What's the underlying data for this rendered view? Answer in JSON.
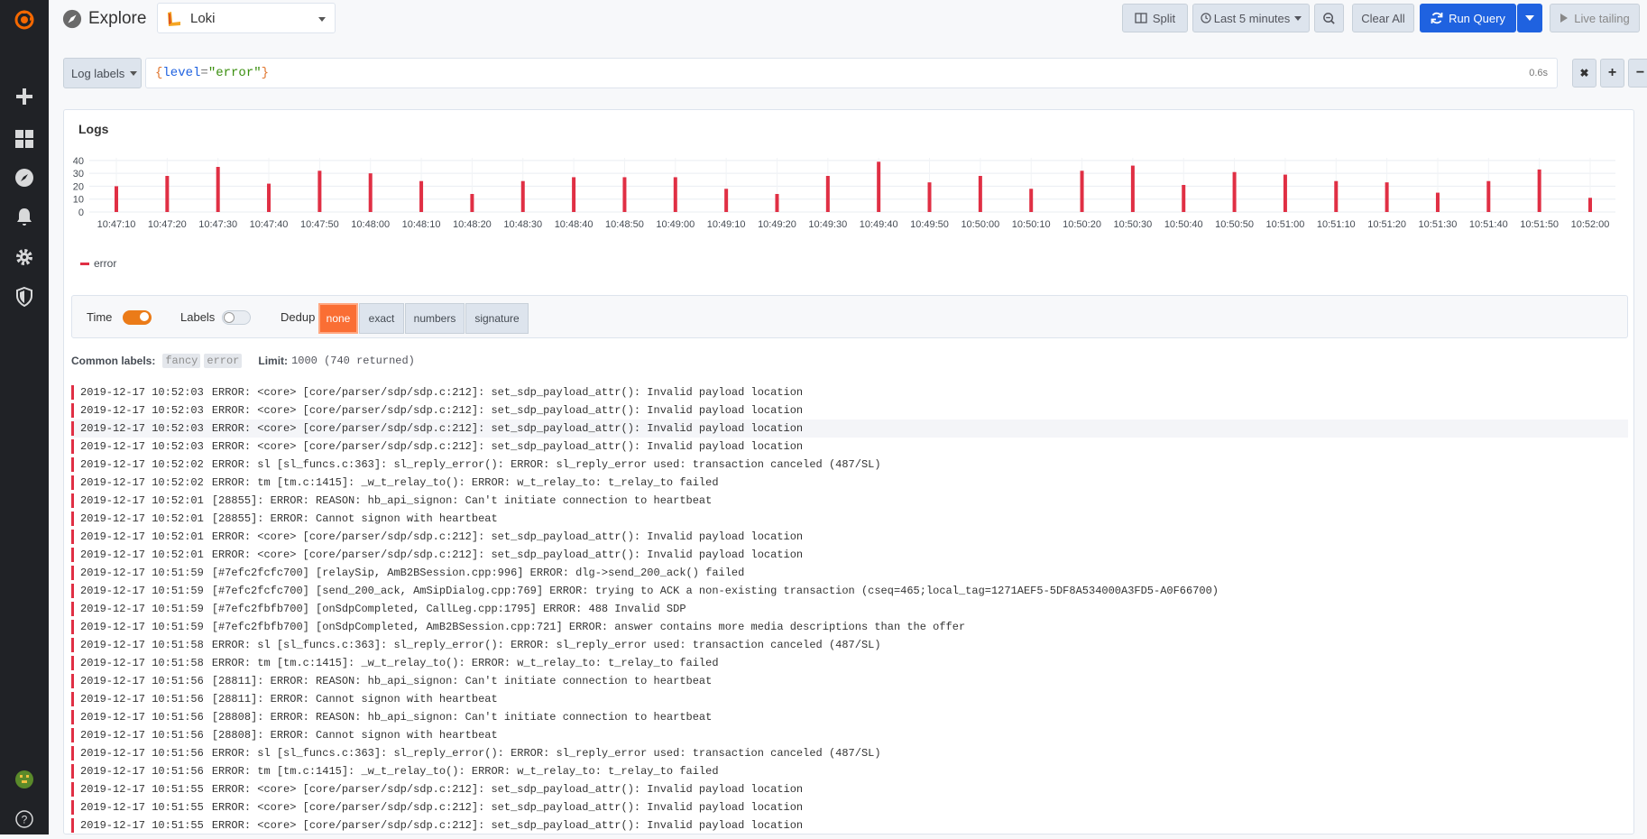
{
  "header": {
    "title": "Explore",
    "datasource": "Loki",
    "split_label": "Split",
    "time_range_label": "Last 5 minutes",
    "clear_all_label": "Clear All",
    "run_query_label": "Run Query",
    "live_tailing_label": "Live tailing"
  },
  "query": {
    "log_labels_label": "Log labels",
    "expr": {
      "open": "{",
      "key": "level",
      "op": "=",
      "value": "\"error\"",
      "close": "}"
    },
    "duration": "0.6s",
    "remove_symbol": "✖",
    "add_symbol": "+",
    "minus_symbol": "−"
  },
  "panel": {
    "title": "Logs",
    "legend_label": "error"
  },
  "chart_data": {
    "type": "bar",
    "yticks": [
      0,
      10,
      20,
      30,
      40
    ],
    "ylim": [
      0,
      42
    ],
    "xticks": [
      "10:47:10",
      "10:47:20",
      "10:47:30",
      "10:47:40",
      "10:47:50",
      "10:48:00",
      "10:48:10",
      "10:48:20",
      "10:48:30",
      "10:48:40",
      "10:48:50",
      "10:49:00",
      "10:49:10",
      "10:49:20",
      "10:49:30",
      "10:49:40",
      "10:49:50",
      "10:50:00",
      "10:50:10",
      "10:50:20",
      "10:50:30",
      "10:50:40",
      "10:50:50",
      "10:51:00",
      "10:51:10",
      "10:51:20",
      "10:51:30",
      "10:51:40",
      "10:51:50",
      "10:52:00"
    ],
    "series": [
      {
        "name": "error",
        "color": "#e02f44",
        "values": [
          20,
          28,
          35,
          22,
          32,
          30,
          24,
          14,
          24,
          27,
          27,
          27,
          18,
          14,
          28,
          39,
          23,
          28,
          18,
          32,
          36,
          21,
          31,
          29,
          24,
          23,
          15,
          24,
          33,
          11
        ]
      }
    ]
  },
  "options": {
    "time_label": "Time",
    "labels_label": "Labels",
    "dedup_label": "Dedup",
    "dedup_options": [
      "none",
      "exact",
      "numbers",
      "signature"
    ],
    "dedup_selected": "none"
  },
  "common": {
    "label": "Common labels:",
    "chips": [
      "fancy",
      "error"
    ],
    "limit_label": "Limit:",
    "limit_value": "1000 (740 returned)"
  },
  "logs": [
    {
      "ts": "2019-12-17 10:52:03",
      "msg": "ERROR: <core> [core/parser/sdp/sdp.c:212]: set_sdp_payload_attr(): Invalid payload location"
    },
    {
      "ts": "2019-12-17 10:52:03",
      "msg": "ERROR: <core> [core/parser/sdp/sdp.c:212]: set_sdp_payload_attr(): Invalid payload location"
    },
    {
      "ts": "2019-12-17 10:52:03",
      "msg": "ERROR: <core> [core/parser/sdp/sdp.c:212]: set_sdp_payload_attr(): Invalid payload location"
    },
    {
      "ts": "2019-12-17 10:52:03",
      "msg": "ERROR: <core> [core/parser/sdp/sdp.c:212]: set_sdp_payload_attr(): Invalid payload location"
    },
    {
      "ts": "2019-12-17 10:52:02",
      "msg": "ERROR: sl [sl_funcs.c:363]: sl_reply_error(): ERROR: sl_reply_error used: transaction canceled (487/SL)"
    },
    {
      "ts": "2019-12-17 10:52:02",
      "msg": "ERROR: tm [tm.c:1415]: _w_t_relay_to(): ERROR: w_t_relay_to: t_relay_to failed"
    },
    {
      "ts": "2019-12-17 10:52:01",
      "msg": "[28855]: ERROR: REASON: hb_api_signon: Can't initiate connection to heartbeat"
    },
    {
      "ts": "2019-12-17 10:52:01",
      "msg": "[28855]: ERROR: Cannot signon with heartbeat"
    },
    {
      "ts": "2019-12-17 10:52:01",
      "msg": "ERROR: <core> [core/parser/sdp/sdp.c:212]: set_sdp_payload_attr(): Invalid payload location"
    },
    {
      "ts": "2019-12-17 10:52:01",
      "msg": "ERROR: <core> [core/parser/sdp/sdp.c:212]: set_sdp_payload_attr(): Invalid payload location"
    },
    {
      "ts": "2019-12-17 10:51:59",
      "msg": "[#7efc2fcfc700] [relaySip, AmB2BSession.cpp:996] ERROR: dlg->send_200_ack() failed"
    },
    {
      "ts": "2019-12-17 10:51:59",
      "msg": "[#7efc2fcfc700] [send_200_ack, AmSipDialog.cpp:769] ERROR: trying to ACK a non-existing transaction (cseq=465;local_tag=1271AEF5-5DF8A534000A3FD5-A0F66700)"
    },
    {
      "ts": "2019-12-17 10:51:59",
      "msg": "[#7efc2fbfb700] [onSdpCompleted, CallLeg.cpp:1795] ERROR: 488 Invalid SDP"
    },
    {
      "ts": "2019-12-17 10:51:59",
      "msg": "[#7efc2fbfb700] [onSdpCompleted, AmB2BSession.cpp:721] ERROR: answer contains more media descriptions than the offer"
    },
    {
      "ts": "2019-12-17 10:51:58",
      "msg": "ERROR: sl [sl_funcs.c:363]: sl_reply_error(): ERROR: sl_reply_error used: transaction canceled (487/SL)"
    },
    {
      "ts": "2019-12-17 10:51:58",
      "msg": "ERROR: tm [tm.c:1415]: _w_t_relay_to(): ERROR: w_t_relay_to: t_relay_to failed"
    },
    {
      "ts": "2019-12-17 10:51:56",
      "msg": "[28811]: ERROR: REASON: hb_api_signon: Can't initiate connection to heartbeat"
    },
    {
      "ts": "2019-12-17 10:51:56",
      "msg": "[28811]: ERROR: Cannot signon with heartbeat"
    },
    {
      "ts": "2019-12-17 10:51:56",
      "msg": "[28808]: ERROR: REASON: hb_api_signon: Can't initiate connection to heartbeat"
    },
    {
      "ts": "2019-12-17 10:51:56",
      "msg": "[28808]: ERROR: Cannot signon with heartbeat"
    },
    {
      "ts": "2019-12-17 10:51:56",
      "msg": "ERROR: sl [sl_funcs.c:363]: sl_reply_error(): ERROR: sl_reply_error used: transaction canceled (487/SL)"
    },
    {
      "ts": "2019-12-17 10:51:56",
      "msg": "ERROR: tm [tm.c:1415]: _w_t_relay_to(): ERROR: w_t_relay_to: t_relay_to failed"
    },
    {
      "ts": "2019-12-17 10:51:55",
      "msg": "ERROR: <core> [core/parser/sdp/sdp.c:212]: set_sdp_payload_attr(): Invalid payload location"
    },
    {
      "ts": "2019-12-17 10:51:55",
      "msg": "ERROR: <core> [core/parser/sdp/sdp.c:212]: set_sdp_payload_attr(): Invalid payload location"
    },
    {
      "ts": "2019-12-17 10:51:55",
      "msg": "ERROR: <core> [core/parser/sdp/sdp.c:212]: set_sdp_payload_attr(): Invalid payload location"
    }
  ],
  "icons": {
    "sidebar": [
      "grafana-logo-icon",
      "plus-icon",
      "dashboards-icon",
      "explore-icon",
      "bell-icon",
      "gear-icon",
      "shield-icon",
      "avatar",
      "help-icon"
    ]
  }
}
